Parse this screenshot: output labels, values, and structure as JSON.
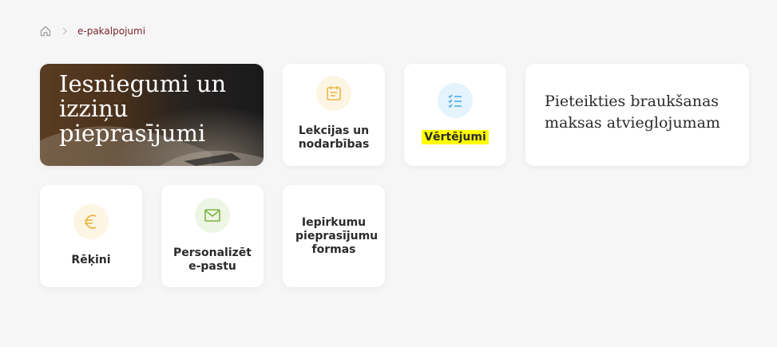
{
  "breadcrumb": {
    "home_icon": "home-icon",
    "separator_icon": "chevron-right-icon",
    "current": "e-pakalpojumi"
  },
  "cards": {
    "iesniegumi": {
      "title": "Iesniegumi un izziņu pieprasījumi"
    },
    "lekcijas": {
      "label": "Lekcijas un nodarbības",
      "icon": "calendar-icon",
      "icon_color": "#e8b84a"
    },
    "vertejumi": {
      "label": "Vērtējumi",
      "icon": "checklist-icon",
      "icon_color": "#45a8e6",
      "highlight": "#ffff00"
    },
    "pieteikties": {
      "title": "Pieteikties braukšanas maksas atvieglojumam"
    },
    "rekini": {
      "label": "Rēķini",
      "icon": "euro-icon",
      "icon_color": "#e8b84a"
    },
    "personalizet": {
      "label": "Personalizēt e-pastu",
      "icon": "envelope-icon",
      "icon_color": "#7cb342"
    },
    "iepirkumu": {
      "label": "Iepirkumu pieprasījumu formas"
    }
  },
  "colors": {
    "background": "#f6f6f6",
    "link": "#7b2434",
    "card": "#ffffff"
  }
}
